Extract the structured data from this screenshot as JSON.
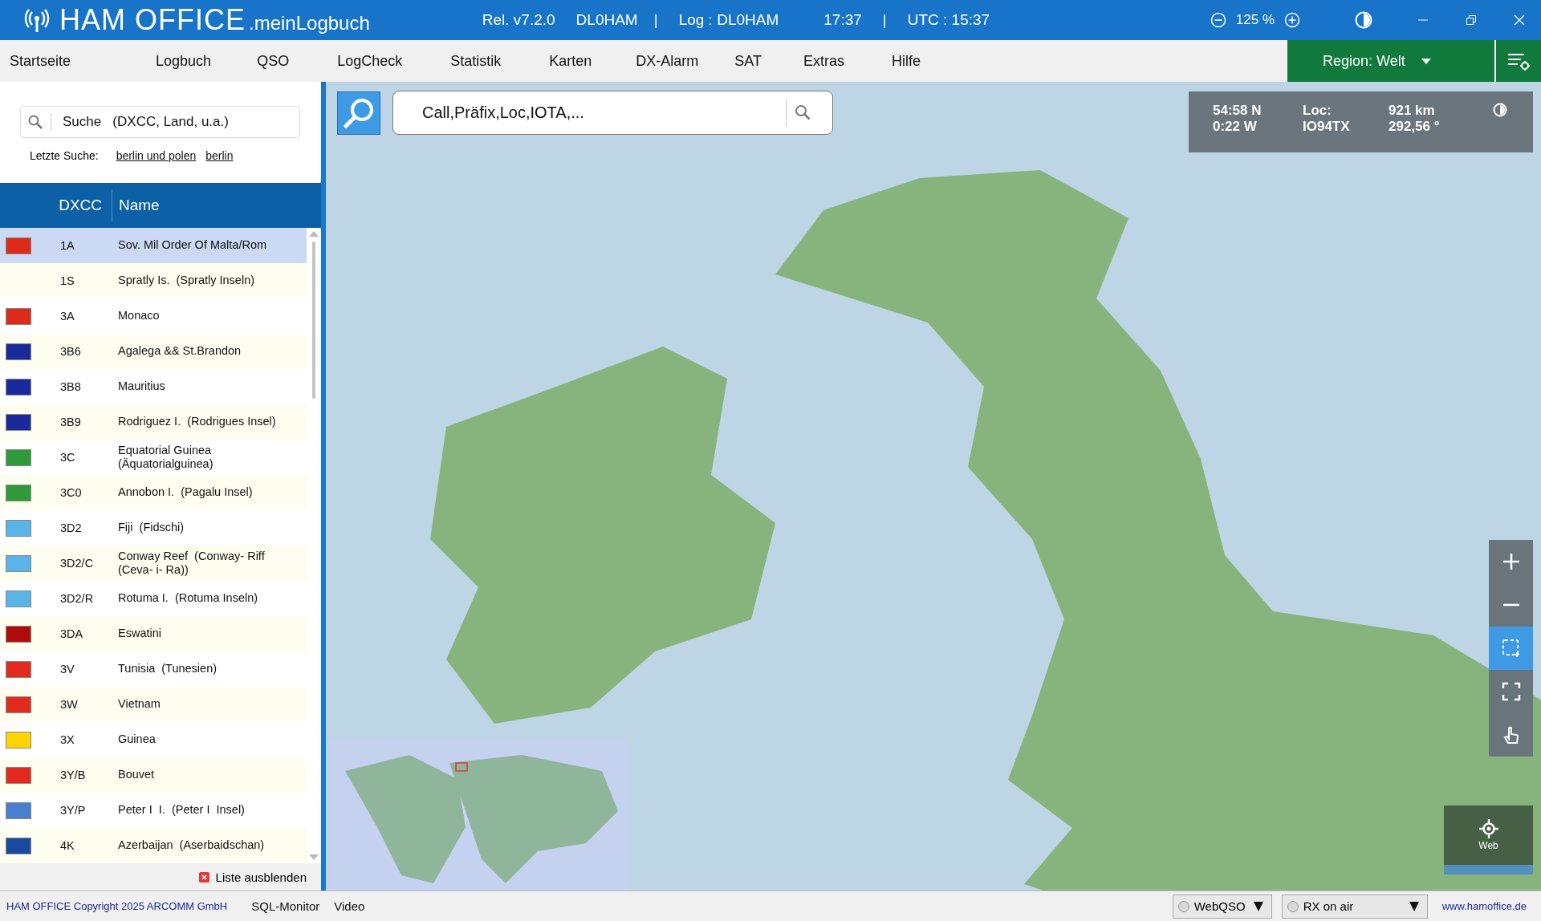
{
  "title_bar": {
    "app_name": "HAM OFFICE",
    "app_suffix": ".meinLogbuch",
    "release": "Rel. v7.2.0",
    "callsign": "DL0HAM",
    "separator_1": "|",
    "log": "Log : DL0HAM",
    "time": "17:37",
    "separator_2": "|",
    "utc": "UTC : 15:37",
    "zoom": "125 %"
  },
  "menu": {
    "items": [
      "Startseite",
      "Logbuch",
      "QSO",
      "LogCheck",
      "Statistik",
      "Karten",
      "DX-Alarm",
      "SAT",
      "Extras",
      "Hilfe"
    ],
    "region": "Region: Welt"
  },
  "sidebar": {
    "search_placeholder": "Suche   (DXCC, Land, u.a.)",
    "recent_label": "Letzte Suche:",
    "recent": [
      "berlin und polen",
      "berlin"
    ],
    "columns": [
      "DXCC",
      "Name"
    ],
    "rows": [
      {
        "dxcc": "1A",
        "name": "Sov. Mil Order Of Malta/Rom",
        "selected": true,
        "color": "#dd2a1b"
      },
      {
        "dxcc": "1S",
        "name": "Spratly Is.  (Spratly Inseln)",
        "selected": false
      },
      {
        "dxcc": "3A",
        "name": "Monaco",
        "selected": false,
        "color": "#dd2a1b"
      },
      {
        "dxcc": "3B6",
        "name": "Agalega && St.Brandon",
        "selected": false,
        "color": "#1a2a9c"
      },
      {
        "dxcc": "3B8",
        "name": "Mauritius",
        "selected": false,
        "color": "#1a2a9c"
      },
      {
        "dxcc": "3B9",
        "name": "Rodriguez I.  (Rodrigues Insel)",
        "selected": false,
        "color": "#1a2a9c"
      },
      {
        "dxcc": "3C",
        "name": "Equatorial Guinea\n(Äquatorialguinea)",
        "selected": false,
        "color": "#2e9a3a"
      },
      {
        "dxcc": "3C0",
        "name": "Annobon I.  (Pagalu Insel)",
        "selected": false,
        "color": "#2e9a3a"
      },
      {
        "dxcc": "3D2",
        "name": "Fiji  (Fidschi)",
        "selected": false,
        "color": "#5ab4e8"
      },
      {
        "dxcc": "3D2/C",
        "name": "Conway Reef  (Conway- Riff\n(Ceva- i- Ra))",
        "selected": false,
        "color": "#5ab4e8"
      },
      {
        "dxcc": "3D2/R",
        "name": "Rotuma I.  (Rotuma Inseln)",
        "selected": false,
        "color": "#5ab4e8"
      },
      {
        "dxcc": "3DA",
        "name": "Eswatini",
        "selected": false,
        "color": "#b10c0c"
      },
      {
        "dxcc": "3V",
        "name": "Tunisia  (Tunesien)",
        "selected": false,
        "color": "#e22a1e"
      },
      {
        "dxcc": "3W",
        "name": "Vietnam",
        "selected": false,
        "color": "#e22a1e"
      },
      {
        "dxcc": "3X",
        "name": "Guinea",
        "selected": false,
        "color": "#ffd500"
      },
      {
        "dxcc": "3Y/B",
        "name": "Bouvet",
        "selected": false,
        "color": "#e22a1e"
      },
      {
        "dxcc": "3Y/P",
        "name": "Peter I  I.  (Peter I  Insel)",
        "selected": false,
        "color": "#4a7fd0"
      },
      {
        "dxcc": "4K",
        "name": "Azerbaijan  (Aserbaidschan)",
        "selected": false,
        "color": "#1a4aa0"
      }
    ],
    "hide_list": "Liste ausblenden"
  },
  "map": {
    "search_placeholder": "Call,Präfix,Loc,IOTA,...",
    "coordinates": {
      "lat": "54:58 N",
      "lon": "0:22 W",
      "loc_label": "Loc:",
      "locator": "IO94TX",
      "distance": "921 km",
      "bearing": "292,56 °"
    },
    "tools": [
      {
        "kind": "zoom-in",
        "selected": false
      },
      {
        "kind": "zoom-out",
        "selected": false
      },
      {
        "kind": "select",
        "selected": true
      },
      {
        "kind": "fullscreen",
        "selected": false
      },
      {
        "kind": "pan",
        "selected": false
      }
    ],
    "locate_label": "Web"
  },
  "status_bar": {
    "copyright": "HAM OFFICE Copyright 2025 ARCOMM GmbH",
    "links": [
      "SQL-Monitor",
      "Video"
    ],
    "dropdowns": [
      {
        "label": "WebQSO",
        "on": false
      },
      {
        "label": "RX on air",
        "on": false
      }
    ],
    "website": "www.hamoffice.de"
  }
}
